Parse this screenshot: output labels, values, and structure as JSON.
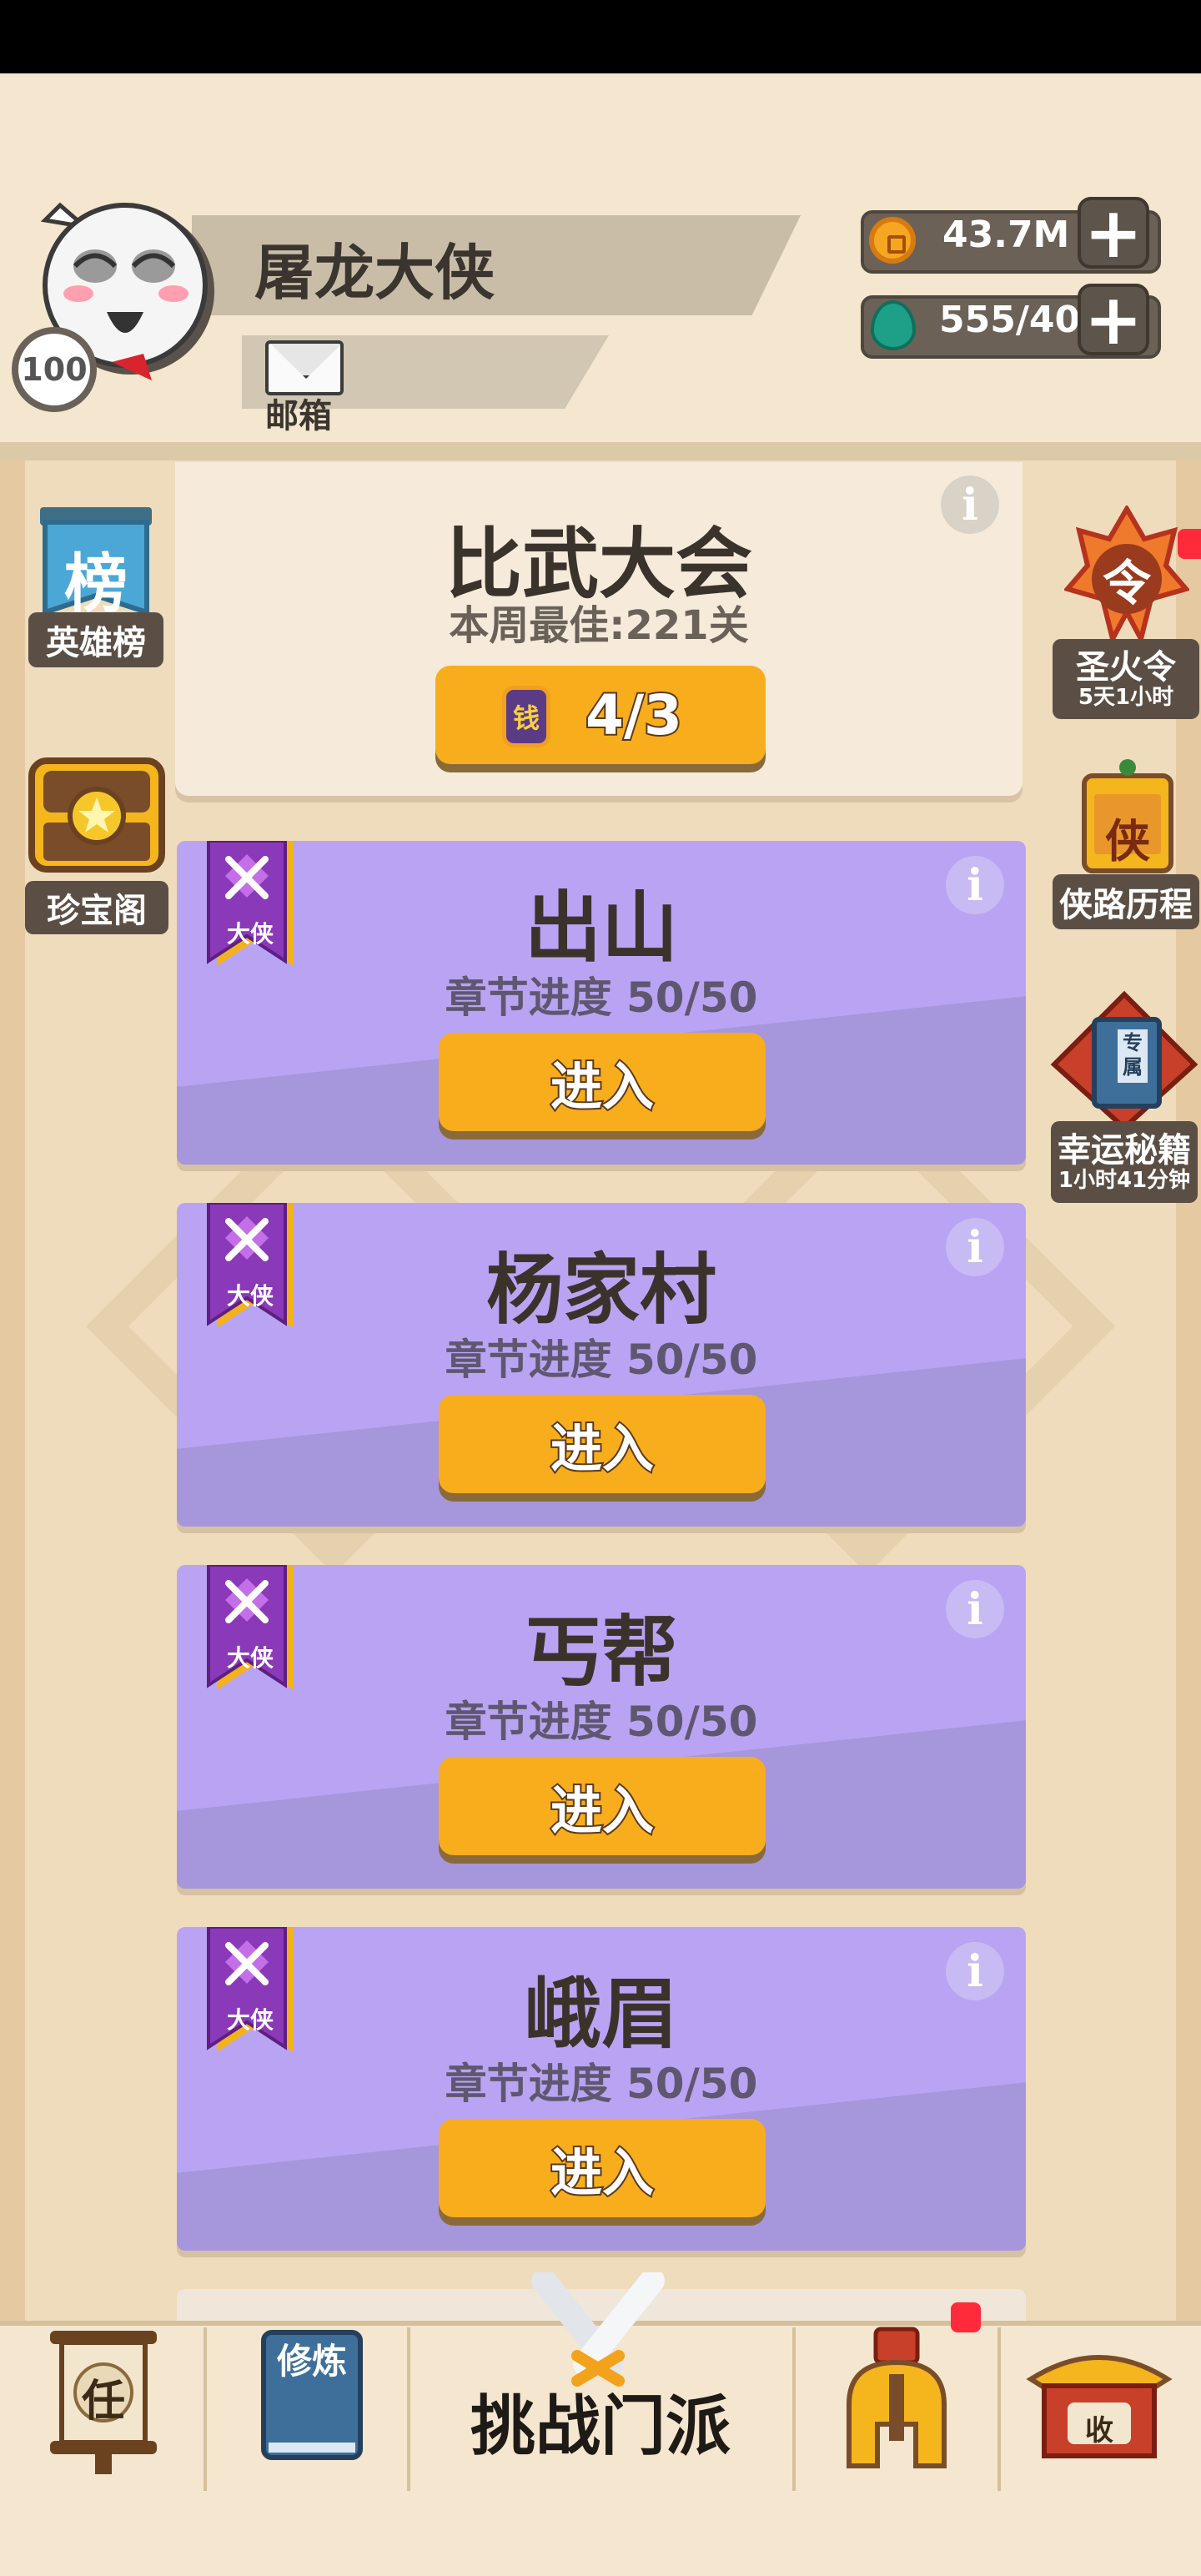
{
  "player": {
    "name": "屠龙大侠",
    "level": "100",
    "mail_label": "邮箱"
  },
  "resources": {
    "coins": "43.7M",
    "gems": "555/40"
  },
  "left_side": [
    {
      "label": "英雄榜",
      "icon_text": "榜"
    },
    {
      "label": "珍宝阁"
    }
  ],
  "right_side": [
    {
      "label": "圣火令",
      "sub": "5天1小时",
      "icon_text": "令"
    },
    {
      "label": "侠路历程",
      "icon_text": "侠"
    },
    {
      "label": "幸运秘籍",
      "sub": "1小时41分钟",
      "icon_text": "专属"
    }
  ],
  "tournament": {
    "title": "比武大会",
    "best": "本周最佳:221关",
    "button": "4/3",
    "coin_text": "钱"
  },
  "stages": [
    {
      "title": "出山",
      "progress": "章节进度 50/50",
      "button": "进入",
      "badge": "大侠"
    },
    {
      "title": "杨家村",
      "progress": "章节进度 50/50",
      "button": "进入",
      "badge": "大侠"
    },
    {
      "title": "丐帮",
      "progress": "章节进度 50/50",
      "button": "进入",
      "badge": "大侠"
    },
    {
      "title": "峨眉",
      "progress": "章节进度 50/50",
      "button": "进入",
      "badge": "大侠"
    }
  ],
  "nav": {
    "task_icon_text": "任",
    "train_icon_text": "修炼",
    "center_label": "挑战门派",
    "shop_icon_text": "收"
  },
  "colors": {
    "accent_yellow": "#f8ad1c",
    "card_purple": "#b9a4f3",
    "badge_red": "#ff2b3a"
  }
}
